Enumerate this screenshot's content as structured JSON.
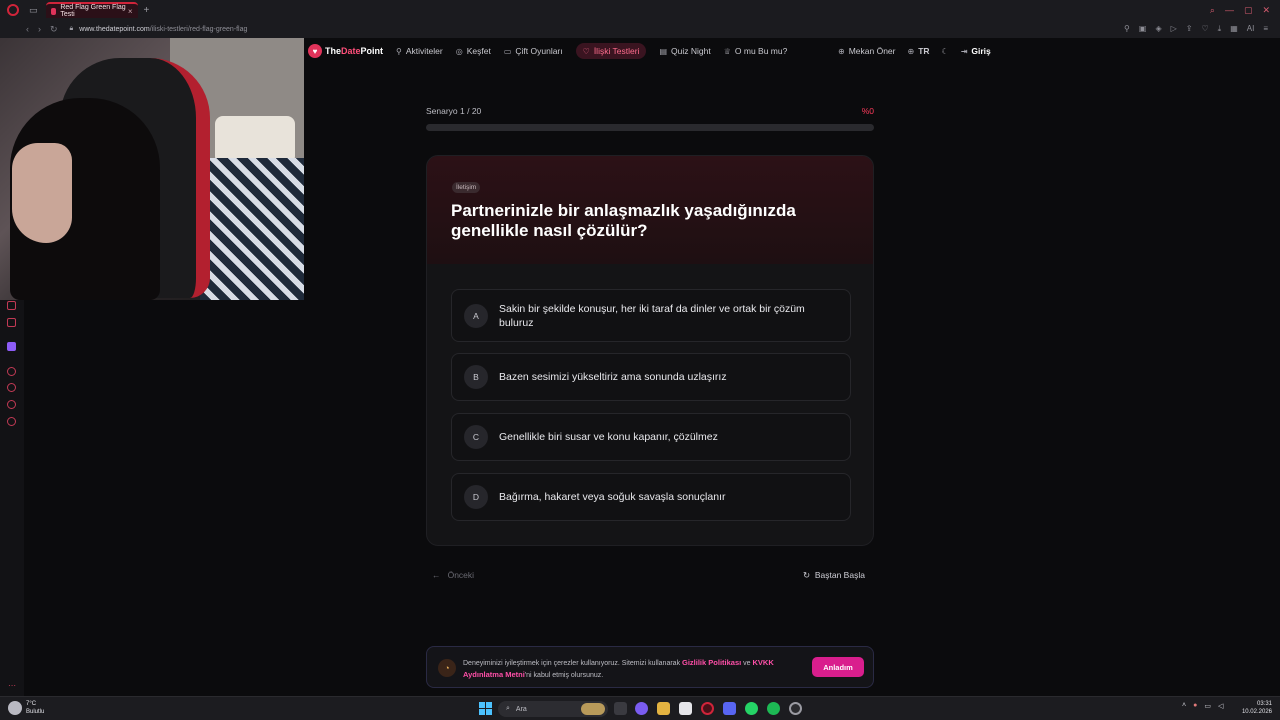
{
  "browser": {
    "tab_title": "Red Flag Green Flag Testi",
    "tab_close": "×",
    "new_tab": "+",
    "url_domain": "www.thedatepoint.com",
    "url_path": "/iliski-testleri/red-flag-green-flag",
    "ai_label": "AI"
  },
  "site": {
    "logo_prefix": "The",
    "logo_highlight": "Date",
    "logo_suffix": "Point",
    "nav": [
      {
        "label": "Aktiviteler",
        "icon": "rocket-icon"
      },
      {
        "label": "Keşfet",
        "icon": "compass-icon"
      },
      {
        "label": "Çift Oyunları",
        "icon": "gamepad-icon"
      },
      {
        "label": "İlişki Testleri",
        "icon": "heart-icon"
      },
      {
        "label": "Quiz Night",
        "icon": "quiz-icon"
      },
      {
        "label": "O mu Bu mu?",
        "icon": "trophy-icon"
      }
    ],
    "suggest_venue": "Mekan Öner",
    "language": "TR",
    "login": "Giriş"
  },
  "quiz": {
    "scenario_label": "Senaryo 1 / 20",
    "progress_percent_label": "%0",
    "progress": 0,
    "category_tag": "İletişim",
    "question": "Partnerinizle bir anlaşmazlık yaşadığınızda genellikle nasıl çözülür?",
    "options": [
      {
        "letter": "A",
        "text": "Sakin bir şekilde konuşur, her iki taraf da dinler ve ortak bir çözüm buluruz"
      },
      {
        "letter": "B",
        "text": "Bazen sesimizi yükseltiriz ama sonunda uzlaşırız"
      },
      {
        "letter": "C",
        "text": "Genellikle biri susar ve konu kapanır, çözülmez"
      },
      {
        "letter": "D",
        "text": "Bağırma, hakaret veya soğuk savaşla sonuçlanır"
      }
    ],
    "prev_label": "Önceki",
    "restart_label": "Baştan Başla"
  },
  "cookie": {
    "text_1": "Deneyiminizi iyileştirmek için çerezler kullanıyoruz. Sitemizi kullanarak ",
    "privacy_link": "Gizlilik Politikası",
    "text_and": " ve ",
    "kvkk_link": "KVKK Aydınlatma Metni",
    "text_2": "'ni kabul etmiş olursunuz.",
    "accept_label": "Anladım"
  },
  "taskbar": {
    "temperature": "7°C",
    "weather_desc": "Bulutlu",
    "search_placeholder": "Ara",
    "time": "03:31",
    "date": "10.02.2026"
  },
  "colors": {
    "accent": "#ff3b5c",
    "brand_pink": "#e0335a",
    "accept_button": "#d91e8d"
  }
}
